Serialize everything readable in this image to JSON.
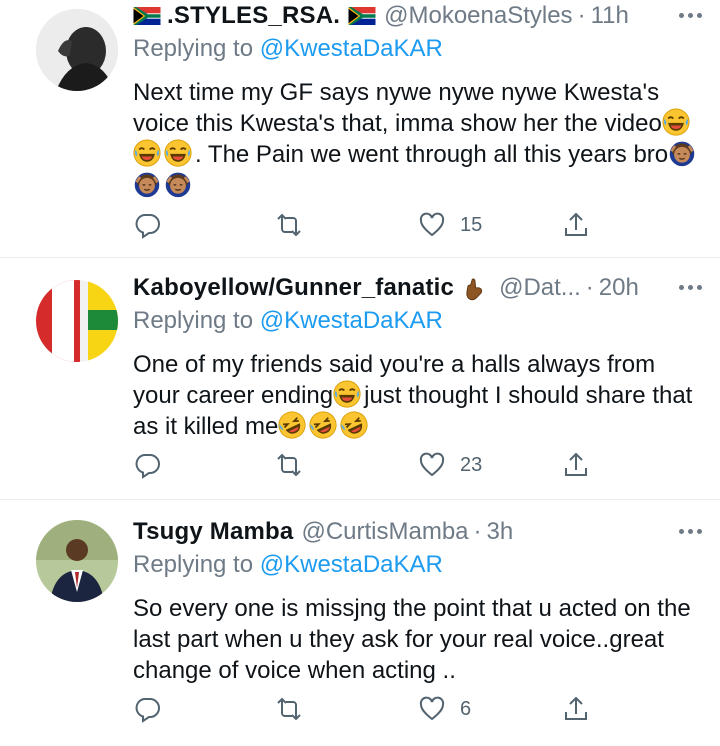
{
  "tweets": [
    {
      "name": ".STYLES_RSA.",
      "handle": "@MokoenaStyles",
      "time": "11h",
      "replying_label": "Replying to",
      "replying_to": "@KwestaDaKAR",
      "text": "Next time my GF says nywe nywe nywe Kwesta's voice this Kwesta's that, imma show her the video",
      "text_after": ". The Pain we went through all this years bro",
      "likes": "15"
    },
    {
      "name": "Kaboyellow/Gunner_fanatic",
      "handle": "@Dat...",
      "time": "20h",
      "replying_label": "Replying to",
      "replying_to": "@KwestaDaKAR",
      "text": "One of my friends said you're a halls always from your career ending",
      "text_after": "just thought I should share that as it killed me",
      "likes": "23"
    },
    {
      "name": "Tsugy Mamba",
      "handle": "@CurtisMamba",
      "time": "3h",
      "replying_label": "Replying to",
      "replying_to": "@KwestaDaKAR",
      "text": "So every one is missjng the point that u acted on the last part when u they ask for your real voice..great change of voice when acting ..",
      "likes": "6"
    }
  ],
  "icons": {
    "reply": "reply-icon",
    "retweet": "retweet-icon",
    "like": "heart-icon",
    "share": "share-icon",
    "more": "more-icon"
  },
  "colors": {
    "link": "#1d9bf0",
    "secondary": "#6e7a86",
    "text": "#0f1419",
    "divider": "#e6ecf0"
  }
}
